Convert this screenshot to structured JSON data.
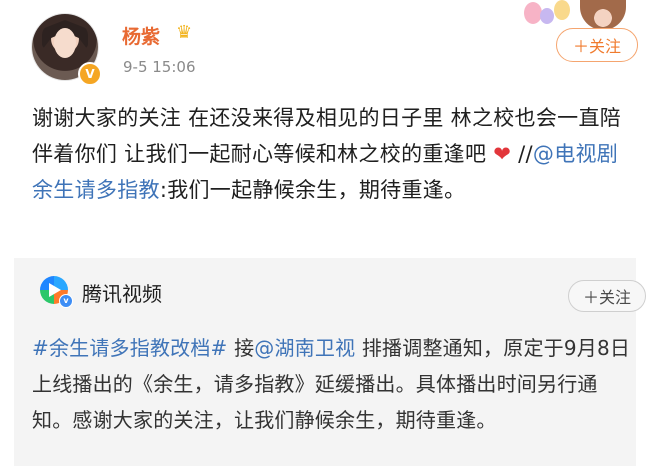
{
  "author": {
    "name": "杨紫",
    "time": "9-5 15:06",
    "badge_icon": "verified-v-icon",
    "crown_icon": "crown-icon",
    "follow_label": "＋关注"
  },
  "post": {
    "text_1": "谢谢大家的关注  在还没来得及相见的日子里 林之校也会一直陪伴着你们 让我们一起耐心等候和林之校的重逢吧 ",
    "heart": "❤",
    "slashes": " //",
    "mention": "@电视剧余生请多指教",
    "text_2": ":我们一起静候余生，期待重逢。"
  },
  "repost": {
    "source_name": "腾讯视频",
    "follow_label": "＋关注",
    "hashtag": "#余生请多指教改档#",
    "text_a": " 接",
    "mention": "@湖南卫视",
    "text_b": " 排播调整通知，原定于9月8日上线播出的《余生，请多指教》延缓播出。具体播出时间另行通知。感谢大家的关注，让我们静候余生，期待重逢。"
  },
  "colors": {
    "name": "#e86a33",
    "link": "#3f74b8",
    "follow_accent": "#f07b2e",
    "repost_bg": "#f4f4f4"
  }
}
